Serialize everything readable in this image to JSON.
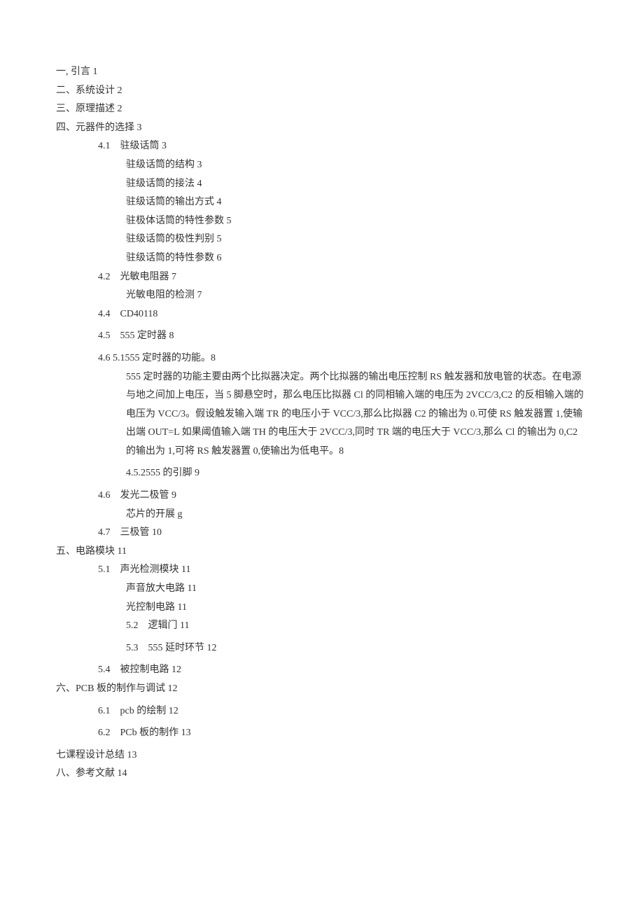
{
  "lines": [
    {
      "cls": "indent-0",
      "text": "一, 引言 1"
    },
    {
      "cls": "indent-0",
      "text": "二、系统设计 2"
    },
    {
      "cls": "indent-0",
      "text": "三、原理描述 2"
    },
    {
      "cls": "indent-0",
      "text": "四、元器件的选择 3"
    },
    {
      "cls": "indent-1",
      "text": "4.1　驻级话筒 3"
    },
    {
      "cls": "indent-2",
      "text": "驻级话筒的结构 3"
    },
    {
      "cls": "indent-2",
      "text": "驻级话筒的接法 4"
    },
    {
      "cls": "indent-2",
      "text": "驻级话筒的输出方式 4"
    },
    {
      "cls": "indent-2",
      "text": "驻极体话筒的特性参数 5"
    },
    {
      "cls": "indent-2",
      "text": "驻级话筒的极性判别 5"
    },
    {
      "cls": "indent-2",
      "text": "驻级话筒的特性参数 6"
    },
    {
      "cls": "indent-1",
      "text": "4.2　光敏电阻器 7"
    },
    {
      "cls": "indent-2",
      "text": "光敏电阻的检测 7"
    },
    {
      "cls": "indent-1",
      "text": "4.4　CD40118"
    },
    {
      "cls": "indent-1 gap",
      "text": "4.5　555 定时器 8"
    },
    {
      "cls": "indent-1 gap",
      "text": "4.6 5.1555 定时器的功能。8"
    },
    {
      "cls": "para",
      "text": "555 定时器的功能主要由两个比拟器决定。两个比拟器的输出电压控制 RS 触发器和放电管的状态。在电源与地之间加上电压，当 5 脚悬空时，那么电压比拟器 Cl 的同相输入端的电压为 2VCC/3,C2 的反相输入端的电压为 VCC/3。假设触发输入端 TR 的电压小于 VCC/3,那么比拟器 C2 的输出为 0.可使 RS 触发器置 1,使输出端 OUT=L 如果阈值输入端 TH 的电压大于 2VCC/3,同时 TR 端的电压大于 VCC/3,那么 Cl 的输出为 0,C2 的输出为 1,可将 RS 触发器置 0,使输出为低电平。8"
    },
    {
      "cls": "indent-2 gap",
      "text": "4.5.2555 的引脚 9"
    },
    {
      "cls": "indent-1 gap",
      "text": "4.6　发光二极管 9"
    },
    {
      "cls": "indent-2",
      "text": "芯片的开展 g"
    },
    {
      "cls": "indent-1",
      "text": "4.7　三极管 10"
    },
    {
      "cls": "indent-0",
      "text": "五、电路模块 11"
    },
    {
      "cls": "indent-1",
      "text": "5.1　声光检测模块 11"
    },
    {
      "cls": "indent-2",
      "text": "声音放大电路 11"
    },
    {
      "cls": "indent-2",
      "text": "光控制电路 11"
    },
    {
      "cls": "indent-2",
      "text": "5.2　逻辑门 11"
    },
    {
      "cls": "indent-2 gap",
      "text": "5.3　555 延时环节 12"
    },
    {
      "cls": "indent-1 gap",
      "text": "5.4　被控制电路 12"
    },
    {
      "cls": "indent-0",
      "text": "六、PCB 板的制作与调试 12"
    },
    {
      "cls": "indent-1 gap",
      "text": "6.1　pcb 的绘制 12"
    },
    {
      "cls": "indent-1 gap",
      "text": "6.2　PCb 板的制作 13"
    },
    {
      "cls": "indent-0 gap",
      "text": "七课程设计总结 13"
    },
    {
      "cls": "indent-0",
      "text": "八、参考文献 14"
    }
  ]
}
